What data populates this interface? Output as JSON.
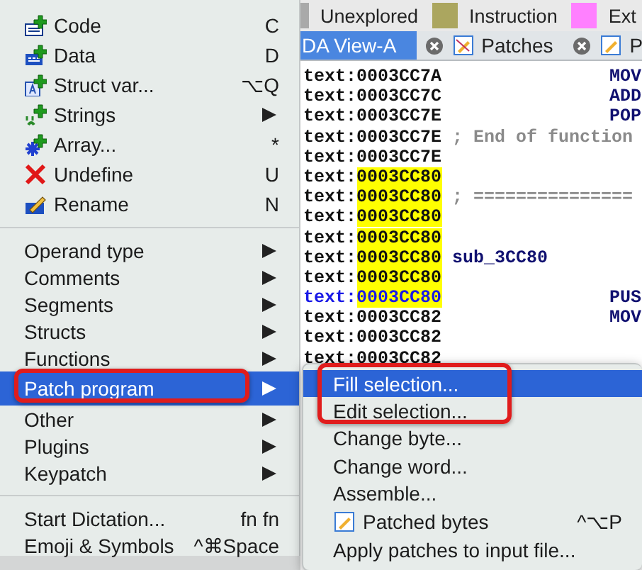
{
  "menu": {
    "items": [
      {
        "kind": "item",
        "label": "Code",
        "shortcut": "C",
        "submenu": false,
        "selected": false
      },
      {
        "kind": "item",
        "label": "Data",
        "shortcut": "D",
        "submenu": false,
        "selected": false
      },
      {
        "kind": "item",
        "label": "Struct var...",
        "shortcut": "⌥Q",
        "submenu": false,
        "selected": false
      },
      {
        "kind": "item",
        "label": "Strings",
        "submenu": true,
        "selected": false
      },
      {
        "kind": "item",
        "label": "Array...",
        "shortcut": "*",
        "submenu": false,
        "selected": false
      },
      {
        "kind": "item",
        "label": "Undefine",
        "shortcut": "U",
        "submenu": false,
        "selected": false
      },
      {
        "kind": "item",
        "label": "Rename",
        "shortcut": "N",
        "submenu": false,
        "selected": false
      },
      {
        "kind": "separator"
      },
      {
        "kind": "item",
        "label": "Operand type",
        "submenu": true,
        "selected": false
      },
      {
        "kind": "item",
        "label": "Comments",
        "submenu": true,
        "selected": false
      },
      {
        "kind": "item",
        "label": "Segments",
        "submenu": true,
        "selected": false
      },
      {
        "kind": "item",
        "label": "Structs",
        "submenu": true,
        "selected": false
      },
      {
        "kind": "item",
        "label": "Functions",
        "submenu": true,
        "selected": false
      },
      {
        "kind": "item",
        "label": "Patch program",
        "submenu": true,
        "selected": true
      },
      {
        "kind": "item",
        "label": "Other",
        "submenu": true,
        "selected": false
      },
      {
        "kind": "item",
        "label": "Plugins",
        "submenu": true,
        "selected": false
      },
      {
        "kind": "item",
        "label": "Keypatch",
        "submenu": true,
        "selected": false
      },
      {
        "kind": "separator"
      },
      {
        "kind": "item",
        "label": "Start Dictation...",
        "shortcut": "fn fn",
        "submenu": false,
        "selected": false
      },
      {
        "kind": "item",
        "label": "Emoji & Symbols",
        "shortcut": "^⌘Space",
        "submenu": false,
        "selected": false
      }
    ]
  },
  "legend": [
    {
      "label": "Unexplored",
      "color": "#a9a9a9"
    },
    {
      "label": "Instruction",
      "color": "#aba65f"
    },
    {
      "label": "Ext",
      "color": "#ff80ff"
    }
  ],
  "tabs": [
    {
      "label": "DA View-A",
      "selected": true,
      "closable": false
    },
    {
      "label": "Patches",
      "selected": false,
      "closable": true
    },
    {
      "label": "P",
      "selected": false,
      "closable": true
    }
  ],
  "listing": [
    {
      "kind": "instruction",
      "segment": "text:",
      "offset": "0003CC7A",
      "highlighted": false,
      "current": false,
      "text": "MOV"
    },
    {
      "kind": "instruction",
      "segment": "text:",
      "offset": "0003CC7C",
      "highlighted": false,
      "current": false,
      "text": "ADD"
    },
    {
      "kind": "instruction",
      "segment": "text:",
      "offset": "0003CC7E",
      "highlighted": false,
      "current": false,
      "text": "POP"
    },
    {
      "kind": "comment",
      "segment": "text:",
      "offset": "0003CC7E",
      "highlighted": false,
      "current": false,
      "text": "; End of function"
    },
    {
      "kind": "blank",
      "segment": "text:",
      "offset": "0003CC7E",
      "highlighted": false,
      "current": false
    },
    {
      "kind": "blank",
      "segment": "text:",
      "offset": "0003CC80",
      "highlighted": true,
      "current": false
    },
    {
      "kind": "comment",
      "segment": "text:",
      "offset": "0003CC80",
      "highlighted": true,
      "current": false,
      "text": "; ==============="
    },
    {
      "kind": "blank",
      "segment": "text:",
      "offset": "0003CC80",
      "highlighted": true,
      "current": false
    },
    {
      "kind": "blank",
      "segment": "text:",
      "offset": "0003CC80",
      "highlighted": true,
      "current": false
    },
    {
      "kind": "label",
      "segment": "text:",
      "offset": "0003CC80",
      "highlighted": true,
      "current": false,
      "text": "sub_3CC80"
    },
    {
      "kind": "blank",
      "segment": "text:",
      "offset": "0003CC80",
      "highlighted": true,
      "current": false
    },
    {
      "kind": "instruction",
      "segment": "text:",
      "offset": "0003CC80",
      "highlighted": true,
      "current": true,
      "text": "PUS"
    },
    {
      "kind": "instruction",
      "segment": "text:",
      "offset": "0003CC82",
      "highlighted": false,
      "current": false,
      "text": "MOV"
    },
    {
      "kind": "blank",
      "segment": "text:",
      "offset": "0003CC82",
      "highlighted": false,
      "current": false
    },
    {
      "kind": "blank",
      "segment": "text:",
      "offset": "0003CC82",
      "highlighted": false,
      "current": false
    }
  ],
  "submenu": {
    "items": [
      {
        "kind": "item",
        "label": "Fill selection...",
        "selected": true
      },
      {
        "kind": "item",
        "label": "Edit selection...",
        "selected": false
      },
      {
        "kind": "item",
        "label": "Change byte...",
        "selected": false
      },
      {
        "kind": "item",
        "label": "Change word...",
        "selected": false
      },
      {
        "kind": "item",
        "label": "Assemble...",
        "selected": false
      },
      {
        "kind": "item",
        "label": "Patched bytes",
        "shortcut": "^⌥P",
        "selected": false
      },
      {
        "kind": "item",
        "label": "Apply patches to input file...",
        "selected": false
      }
    ]
  }
}
